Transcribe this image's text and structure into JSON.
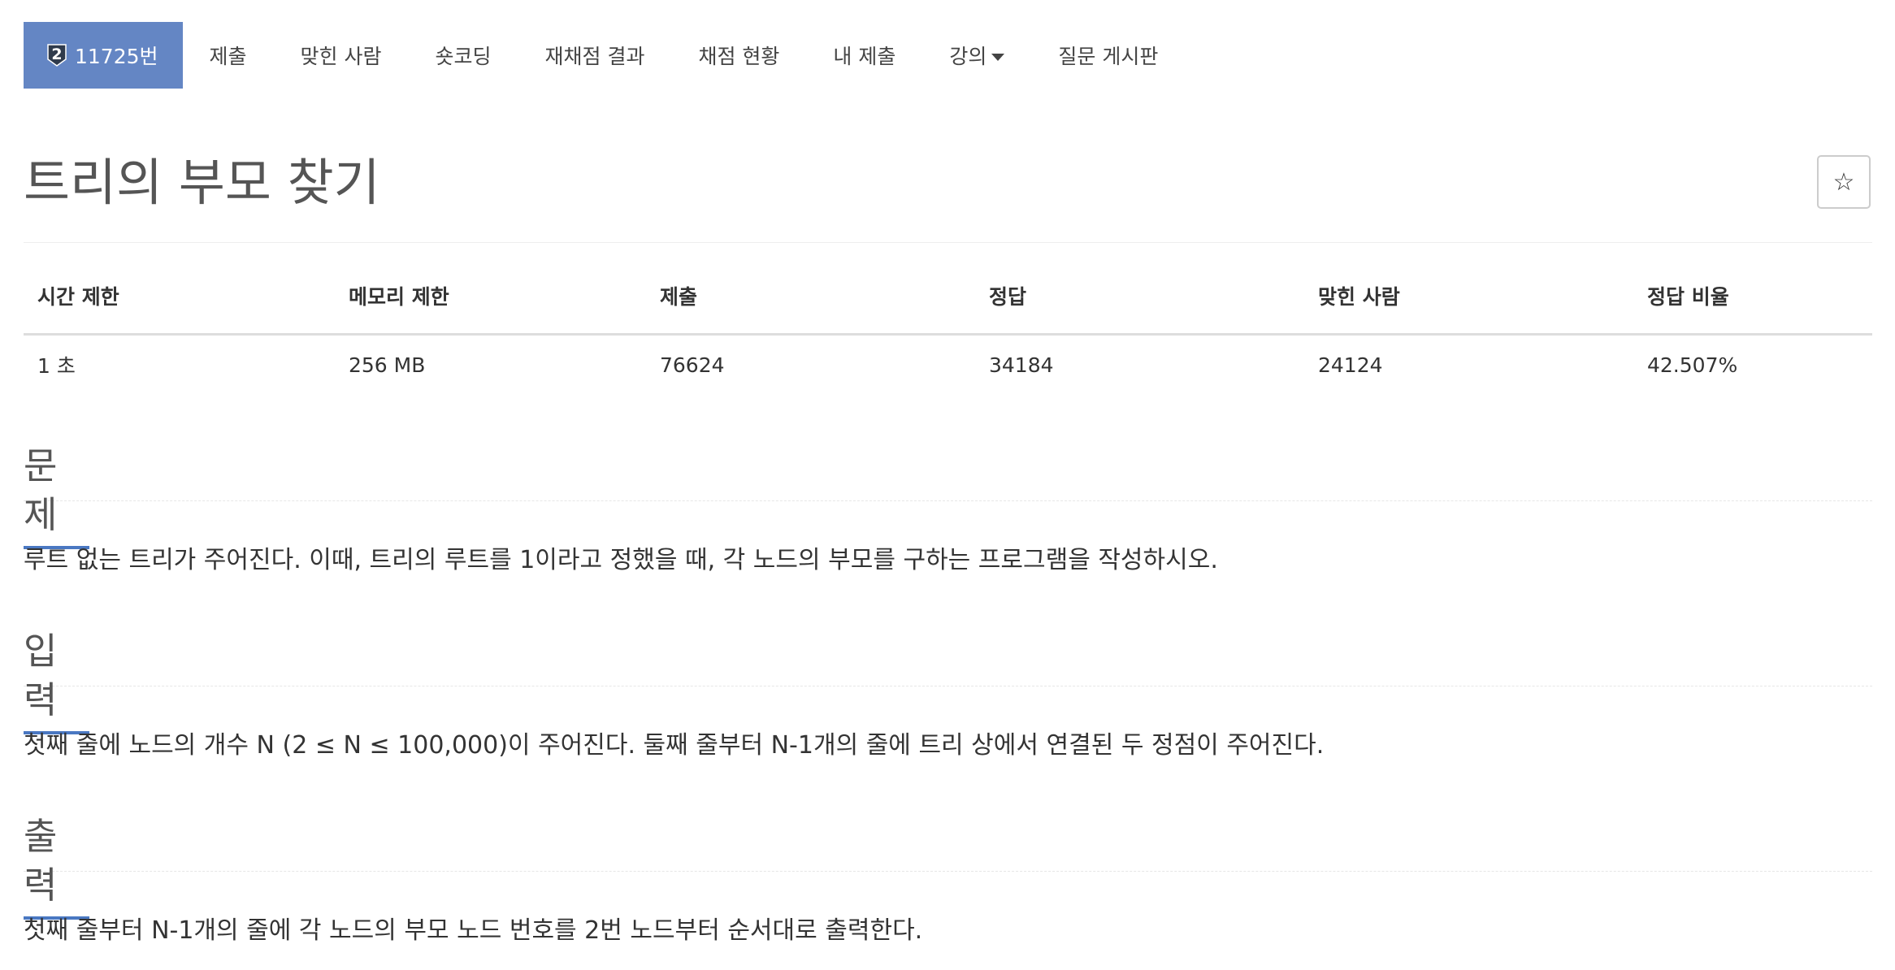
{
  "nav": {
    "problem_badge_number": "2",
    "problem_id_label": "11725번",
    "items": [
      "제출",
      "맞힌 사람",
      "숏코딩",
      "재채점 결과",
      "채점 현황",
      "내 제출",
      "강의",
      "질문 게시판"
    ]
  },
  "problem": {
    "title": "트리의 부모 찾기",
    "star_glyph": "☆"
  },
  "info_table": {
    "headers": [
      "시간 제한",
      "메모리 제한",
      "제출",
      "정답",
      "맞힌 사람",
      "정답 비율"
    ],
    "values": [
      "1 초",
      "256 MB",
      "76624",
      "34184",
      "24124",
      "42.507%"
    ]
  },
  "sections": [
    {
      "heading": "문제",
      "body": "루트 없는 트리가 주어진다. 이때, 트리의 루트를 1이라고 정했을 때, 각 노드의 부모를 구하는 프로그램을 작성하시오."
    },
    {
      "heading": "입력",
      "body": "첫째 줄에 노드의 개수 N (2 ≤ N ≤ 100,000)이 주어진다. 둘째 줄부터 N-1개의 줄에 트리 상에서 연결된 두 정점이 주어진다."
    },
    {
      "heading": "출력",
      "body": "첫째 줄부터 N-1개의 줄에 각 노드의 부모 노드 번호를 2번 노드부터 순서대로 출력한다."
    }
  ],
  "colors": {
    "active_tab": "#6486c4",
    "section_underline": "#4a78c2",
    "badge": "#2f3b4c"
  },
  "icons": {
    "tier_badge": "tier-badge-icon",
    "star": "star-icon",
    "dropdown": "caret-down-icon"
  }
}
